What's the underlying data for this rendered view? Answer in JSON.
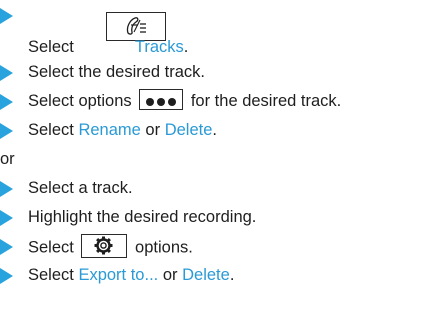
{
  "steps": [
    {
      "select": "Select",
      "tracks_label": "Tracks",
      "period": ".",
      "icon": "tracks-edit-icon"
    },
    {
      "text": "Select the desired track."
    },
    {
      "before": "Select options",
      "after": "for the desired track.",
      "icon": "options-dots-icon"
    },
    {
      "select": "Select",
      "option_a": "Rename",
      "or": "or",
      "option_b": "Delete",
      "period": "."
    }
  ],
  "separator": "or",
  "steps_b": [
    {
      "text": "Select a track."
    },
    {
      "text": "Highlight the desired recording."
    },
    {
      "before": "Select",
      "after": "options.",
      "icon": "settings-gear-icon"
    },
    {
      "select": "Select",
      "option_a": "Export to...",
      "or": "or",
      "option_b": "Delete",
      "period": "."
    }
  ],
  "colors": {
    "accent": "#29a3dd",
    "link": "#2a9ad6",
    "text": "#1e1e1e"
  }
}
